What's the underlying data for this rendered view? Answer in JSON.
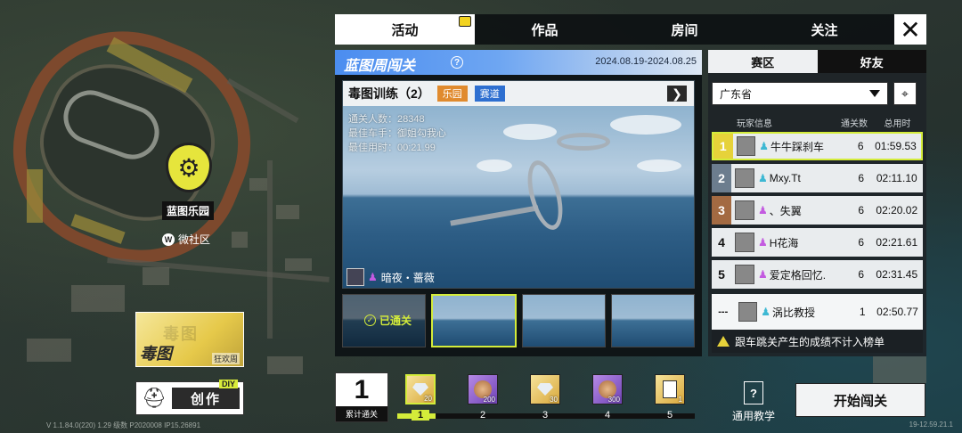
{
  "map": {
    "park_label": "蓝图乐园",
    "community_label": "微社区",
    "community_icon": "W",
    "event_card": {
      "title": "毒图",
      "subtitle": "狂欢周"
    },
    "create_button": {
      "label": "创作",
      "tag": "DIY"
    },
    "version_text": "V 1.1.84.0(220) 1.29 级数 P2020008 IP15.26891",
    "version_right": "19-12.59.21.1"
  },
  "top_tabs": [
    {
      "label": "活动",
      "active": true,
      "badge": true
    },
    {
      "label": "作品",
      "active": false
    },
    {
      "label": "房间",
      "active": false
    },
    {
      "label": "关注",
      "active": false
    }
  ],
  "close_icon": "✕",
  "event": {
    "title": "蓝图周闯关",
    "help_icon": "?",
    "date_range": "2024.08.19-2024.08.25"
  },
  "level": {
    "name": "毒图训练（2）",
    "tags": [
      "乐园",
      "赛道"
    ],
    "next_icon": "❯",
    "stats": {
      "clears": "通关人数：28348",
      "best_racer": "最佳车手：御姐勾我心",
      "best_time": "最佳用时：00:21.99"
    },
    "creator": "暗夜・蔷薇"
  },
  "thumbnails": [
    {
      "state": "done",
      "label": "已通关"
    },
    {
      "state": "selected",
      "label": ""
    },
    {
      "state": "normal",
      "label": ""
    },
    {
      "state": "normal",
      "label": ""
    }
  ],
  "leaderboard": {
    "tabs": [
      "赛区",
      "好友"
    ],
    "region": "广东省",
    "headers": [
      "玩家信息",
      "通关数",
      "总用时"
    ],
    "rows": [
      {
        "rank": "1",
        "name": "牛牛踩刹车",
        "count": "6",
        "time": "01:59.53",
        "gender": "male"
      },
      {
        "rank": "2",
        "name": "Mxy.Tt",
        "count": "6",
        "time": "02:11.10",
        "gender": "male"
      },
      {
        "rank": "3",
        "name": "、失翼",
        "count": "6",
        "time": "02:20.02",
        "gender": "female"
      },
      {
        "rank": "4",
        "name": "H花海",
        "count": "6",
        "time": "02:21.61",
        "gender": "female"
      },
      {
        "rank": "5",
        "name": "爱定格回忆.",
        "count": "6",
        "time": "02:31.45",
        "gender": "female"
      }
    ],
    "mine": {
      "rank": "---",
      "name": "涡比教授",
      "count": "1",
      "time": "02:50.77",
      "gender": "male"
    },
    "warning": "跟车跳关产生的成绩不计入榜单"
  },
  "progress": {
    "total": "1",
    "total_label": "累计通关",
    "fraction": 0.13,
    "rewards": [
      {
        "step": "1",
        "type": "gem",
        "qty": "20",
        "color": "gold",
        "active": true
      },
      {
        "step": "2",
        "type": "coin",
        "qty": "200",
        "color": "purple",
        "active": false
      },
      {
        "step": "3",
        "type": "gem",
        "qty": "30",
        "color": "gold",
        "active": false
      },
      {
        "step": "4",
        "type": "coin",
        "qty": "300",
        "color": "purple",
        "active": false
      },
      {
        "step": "5",
        "type": "card",
        "qty": "1",
        "color": "gold",
        "active": false
      }
    ]
  },
  "tutorial": {
    "label": "通用教学",
    "icon": "?"
  },
  "start_button": "开始闯关"
}
